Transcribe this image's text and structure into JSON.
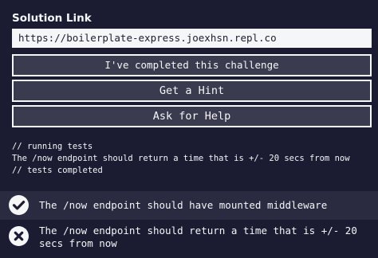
{
  "solution": {
    "label": "Solution Link",
    "value": "https://boilerplate-express.joexhsn.repl.co"
  },
  "buttons": {
    "complete": "I've completed this challenge",
    "hint": "Get a Hint",
    "help": "Ask for Help"
  },
  "console": {
    "lines": [
      "// running tests",
      "The /now endpoint should return a time that is +/- 20 secs from now",
      "// tests completed"
    ]
  },
  "tests": [
    {
      "status": "passed",
      "icon": "check-circle-icon",
      "text": "The /now endpoint should have mounted middleware"
    },
    {
      "status": "failed",
      "icon": "x-circle-icon",
      "text": "The /now endpoint should return a time that is +/- 20 secs from now"
    }
  ],
  "colors": {
    "background": "#1b1b32",
    "button_bg": "#3b3b4f",
    "foreground": "#f5f6f7",
    "pass_row_bg": "#2a2a40"
  }
}
